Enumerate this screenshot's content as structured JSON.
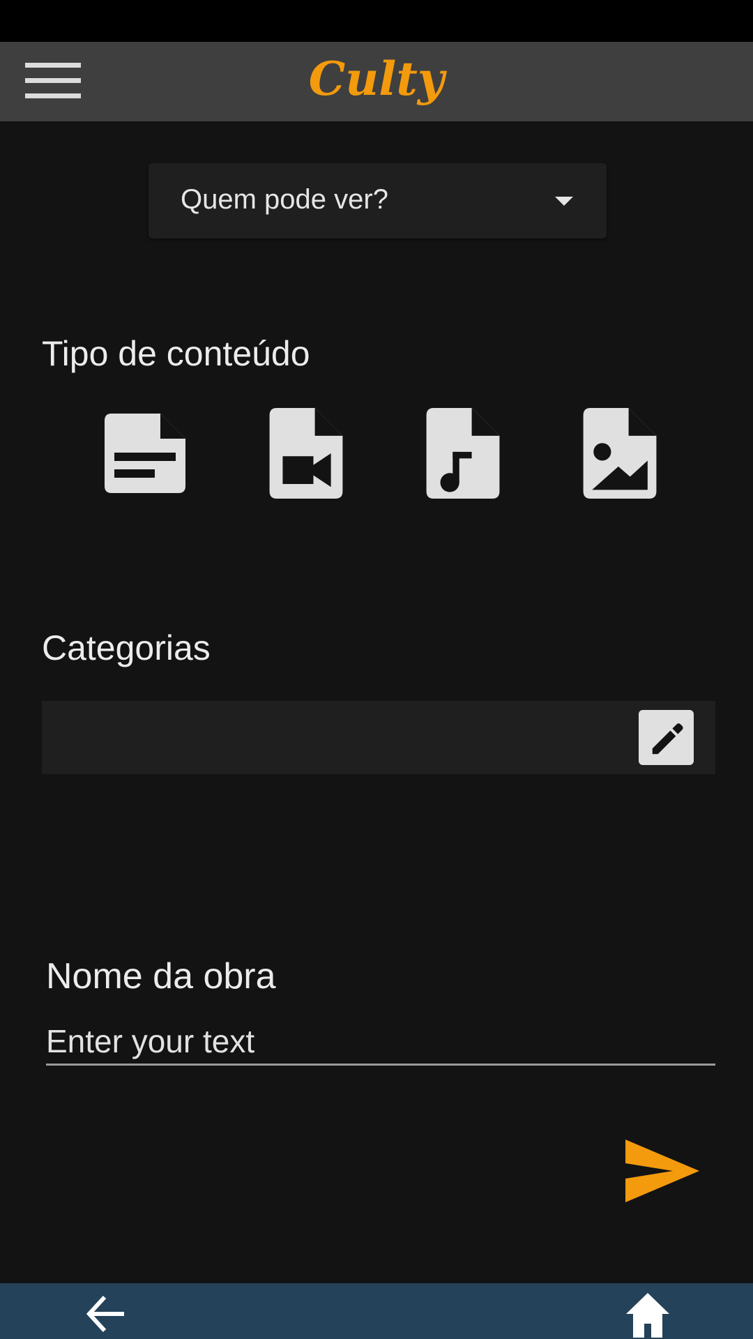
{
  "app": {
    "title": "Culty",
    "accent_color": "#f39a0d"
  },
  "header": {
    "menu_icon": "menu-icon"
  },
  "visibility": {
    "placeholder": "Quem pode ver?",
    "icon": "dropdown-caret-icon"
  },
  "content_type": {
    "title": "Tipo de conteúdo",
    "options": [
      {
        "icon": "text-document-icon"
      },
      {
        "icon": "video-file-icon"
      },
      {
        "icon": "audio-file-icon"
      },
      {
        "icon": "image-file-icon"
      }
    ]
  },
  "categories": {
    "title": "Categorias",
    "edit_icon": "pencil-icon"
  },
  "work_name": {
    "label": "Nome da obra",
    "placeholder": "Enter your text"
  },
  "actions": {
    "send_icon": "send-icon"
  },
  "nav": {
    "back_icon": "back-arrow-icon",
    "home_icon": "home-icon"
  }
}
